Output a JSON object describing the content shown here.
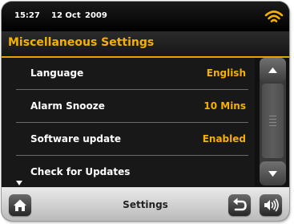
{
  "status": {
    "time": "15:27",
    "date": "12 Oct",
    "year": "2009",
    "wifi_icon": "wifi-signal-icon"
  },
  "header": {
    "title": "Miscellaneous Settings",
    "accent_color": "#f5b000"
  },
  "settings": [
    {
      "label": "Language",
      "value": "English"
    },
    {
      "label": "Alarm Snooze",
      "value": "10 Mins"
    },
    {
      "label": "Software update",
      "value": "Enabled"
    },
    {
      "label": "Check for Updates",
      "value": ""
    }
  ],
  "scroll": {
    "up_icon": "triangle-up-icon",
    "down_icon": "triangle-down-icon",
    "more_icon": "more-below-icon"
  },
  "footer": {
    "title": "Settings",
    "home_icon": "home-icon",
    "back_icon": "back-arrow-icon",
    "volume_icon": "speaker-volume-icon"
  }
}
